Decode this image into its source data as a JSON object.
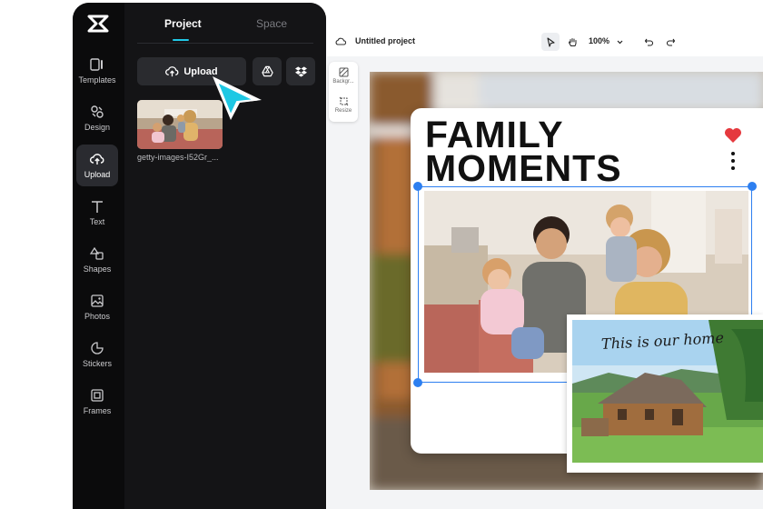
{
  "rail": {
    "items": [
      {
        "label": "Templates",
        "icon": "templates-icon"
      },
      {
        "label": "Design",
        "icon": "design-icon"
      },
      {
        "label": "Upload",
        "icon": "upload-icon",
        "active": true
      },
      {
        "label": "Text",
        "icon": "text-icon"
      },
      {
        "label": "Shapes",
        "icon": "shapes-icon"
      },
      {
        "label": "Photos",
        "icon": "photos-icon"
      },
      {
        "label": "Stickers",
        "icon": "stickers-icon"
      },
      {
        "label": "Frames",
        "icon": "frames-icon"
      }
    ]
  },
  "panel": {
    "tabs": [
      {
        "label": "Project",
        "active": true
      },
      {
        "label": "Space",
        "active": false
      }
    ],
    "upload_label": "Upload",
    "thumb_name": "getty-images-I52Gr_..."
  },
  "toolbar": {
    "title": "Untitled project",
    "zoom": "100%"
  },
  "side_tools": {
    "background": "Backgr...",
    "resize": "Resize"
  },
  "design": {
    "headline_line1": "FAMILY",
    "headline_line2": "MOMENTS",
    "caption": "This is our home"
  },
  "colors": {
    "accent": "#21c8e6",
    "selection": "#2d7ff0",
    "heart": "#e5393e"
  }
}
